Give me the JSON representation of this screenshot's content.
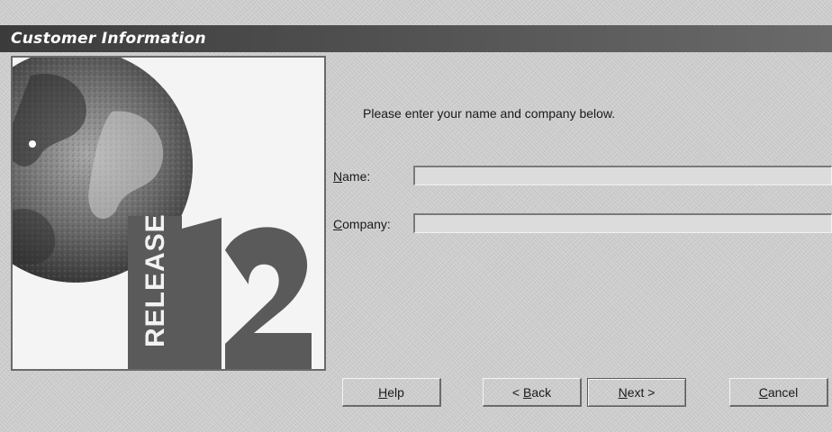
{
  "window": {
    "title": "Customer Information"
  },
  "graphic": {
    "name": "globe-release-12-image",
    "badge_text": "RELEASE",
    "version": "12",
    "colors": {
      "globe_dark": "#3a3a3a",
      "globe_light": "#9a9a9a",
      "badge": "#5a5a5a",
      "background": "#f4f4f4"
    }
  },
  "form": {
    "prompt": "Please enter your name and company below.",
    "name": {
      "label_prefix": "",
      "label_mnemonic": "N",
      "label_suffix": "ame:",
      "value": ""
    },
    "company": {
      "label_prefix": "",
      "label_mnemonic": "C",
      "label_suffix": "ompany:",
      "value": ""
    }
  },
  "buttons": {
    "help": {
      "prefix": "",
      "mnemonic": "H",
      "suffix": "elp"
    },
    "back": {
      "prefix": "< ",
      "mnemonic": "B",
      "suffix": "ack"
    },
    "next": {
      "prefix": "",
      "mnemonic": "N",
      "suffix": "ext >"
    },
    "cancel": {
      "prefix": "",
      "mnemonic": "C",
      "suffix": "ancel"
    }
  }
}
